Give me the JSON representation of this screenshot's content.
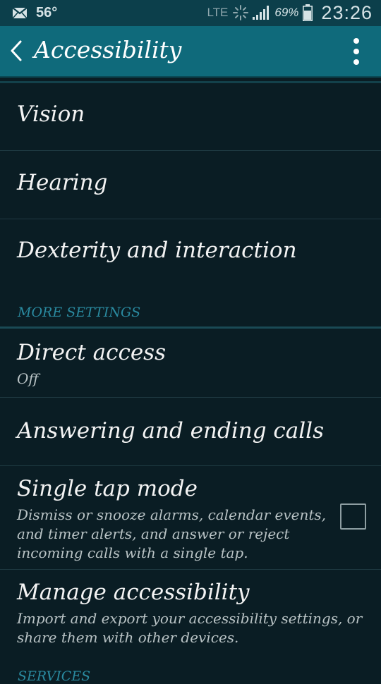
{
  "status_bar": {
    "temperature": "56°",
    "network": "LTE",
    "battery": "69%",
    "time": "23:26",
    "icons": [
      "mail-icon",
      "sync-icon",
      "signal-icon",
      "battery-icon"
    ]
  },
  "action_bar": {
    "title": "Accessibility",
    "icons": [
      "back-arrow-icon",
      "overflow-menu-icon"
    ]
  },
  "items": {
    "vision": {
      "title": "Vision"
    },
    "hearing": {
      "title": "Hearing"
    },
    "dexterity": {
      "title": "Dexterity and interaction"
    }
  },
  "more_settings": {
    "header": "MORE SETTINGS",
    "direct_access": {
      "title": "Direct access",
      "subtitle": "Off"
    },
    "answering": {
      "title": "Answering and ending calls"
    },
    "single_tap": {
      "title": "Single tap mode",
      "subtitle": "Dismiss or snooze alarms, calendar events, and timer alerts, and answer or reject incoming calls with a single tap.",
      "checked": false
    },
    "manage": {
      "title": "Manage accessibility",
      "subtitle": "Import and export your accessibility settings, or share them with other devices."
    }
  },
  "services_header": "SERVICES",
  "colors": {
    "background": "#0a1d24",
    "action_bar": "#0f6a7b",
    "section_header": "#2a8aa0"
  }
}
